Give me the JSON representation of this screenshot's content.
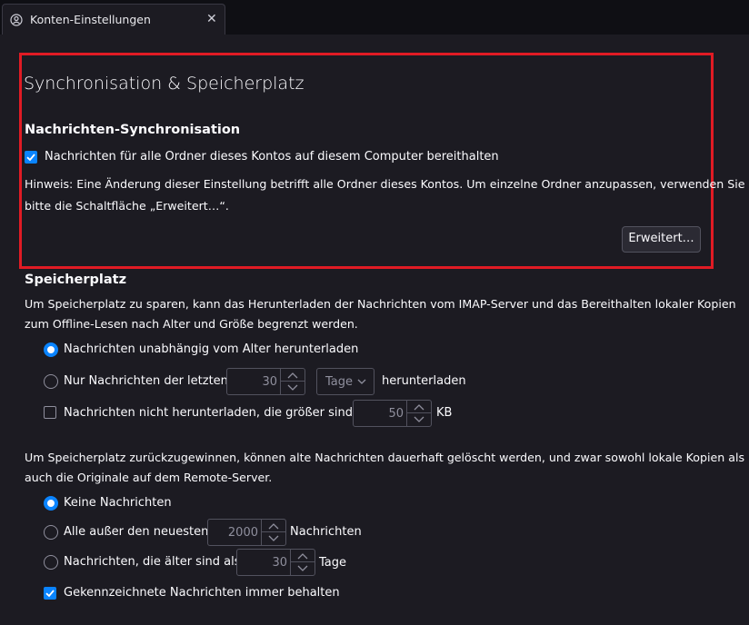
{
  "tab": {
    "title": "Konten-Einstellungen",
    "close": "✕"
  },
  "sync": {
    "heading": "Synchronisation & Speicherplatz",
    "subheading": "Nachrichten-Synchronisation",
    "keep_label": "Nachrichten für alle Ordner dieses Kontos auf diesem Computer bereithalten",
    "keep_checked": true,
    "hint_line1": "Hinweis: Eine Änderung dieser Einstellung betrifft alle Ordner dieses Kontos. Um einzelne Ordner anzupassen, verwenden Sie",
    "hint_line2": "bitte die Schaltfläche „Erweitert…“.",
    "advanced_button": "Erweitert…"
  },
  "storage": {
    "heading": "Speicherplatz",
    "desc_line1": "Um Speicherplatz zu sparen, kann das Herunterladen der Nachrichten vom IMAP-Server und das Bereithalten lokaler Kopien",
    "desc_line2": "zum Offline-Lesen nach Alter und Größe begrenzt werden.",
    "opt_all": "Nachrichten unabhängig vom Alter herunterladen",
    "opt_recent": "Nur Nachrichten der letzten",
    "recent_value": "30",
    "recent_unit": "Tage",
    "recent_suffix": "herunterladen",
    "size_label": "Nachrichten nicht herunterladen, die größer sind als",
    "size_checked": false,
    "size_value": "50",
    "size_unit": "KB",
    "reclaim_line1": "Um Speicherplatz zurückzugewinnen, können alte Nachrichten dauerhaft gelöscht werden, und zwar sowohl lokale Kopien als",
    "reclaim_line2": "auch die Originale auf dem Remote-Server.",
    "del_none": "Keine Nachrichten",
    "del_except": "Alle außer den neuesten",
    "except_value": "2000",
    "except_suffix": "Nachrichten",
    "del_older": "Nachrichten, die älter sind als",
    "older_value": "30",
    "older_suffix": "Tage",
    "keep_flagged": "Gekennzeichnete Nachrichten immer behalten",
    "keep_flagged_checked": true
  },
  "colors": {
    "accent": "#0a84ff",
    "highlight": "#e01b24",
    "background": "#1c1b22"
  }
}
